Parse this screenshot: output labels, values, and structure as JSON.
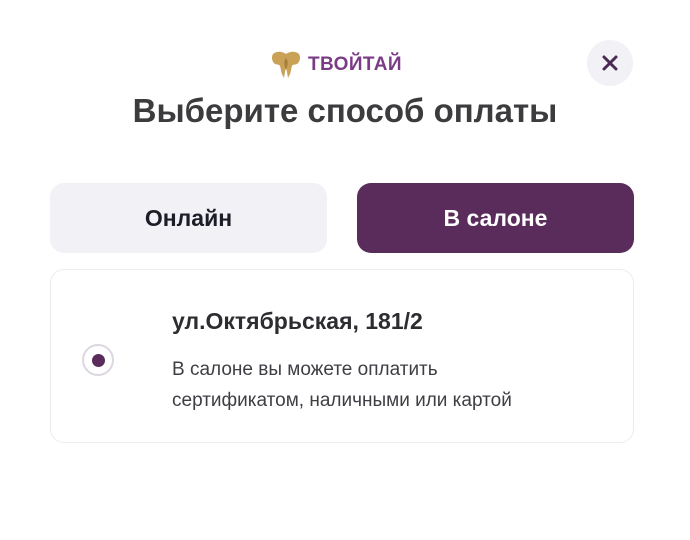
{
  "logo": {
    "text": "ТВОЙТАЙ",
    "icon": "elephant-icon"
  },
  "close": {
    "icon": "close-icon"
  },
  "title": "Выберите способ оплаты",
  "tabs": [
    {
      "label": "Онлайн",
      "selected": false
    },
    {
      "label": "В салоне",
      "selected": true
    }
  ],
  "location": {
    "address": "ул.Октябрьская, 181/2",
    "description_lines": [
      "В салоне вы можете оплатить",
      "сертификатом, наличными или картой"
    ],
    "selected": true
  },
  "colors": {
    "accent": "#5a2c5c",
    "logo_text": "#7b3c86",
    "logo_gold": "#c9a257",
    "inactive_tab": "#f1f1f6",
    "title": "#3c3c3e"
  }
}
